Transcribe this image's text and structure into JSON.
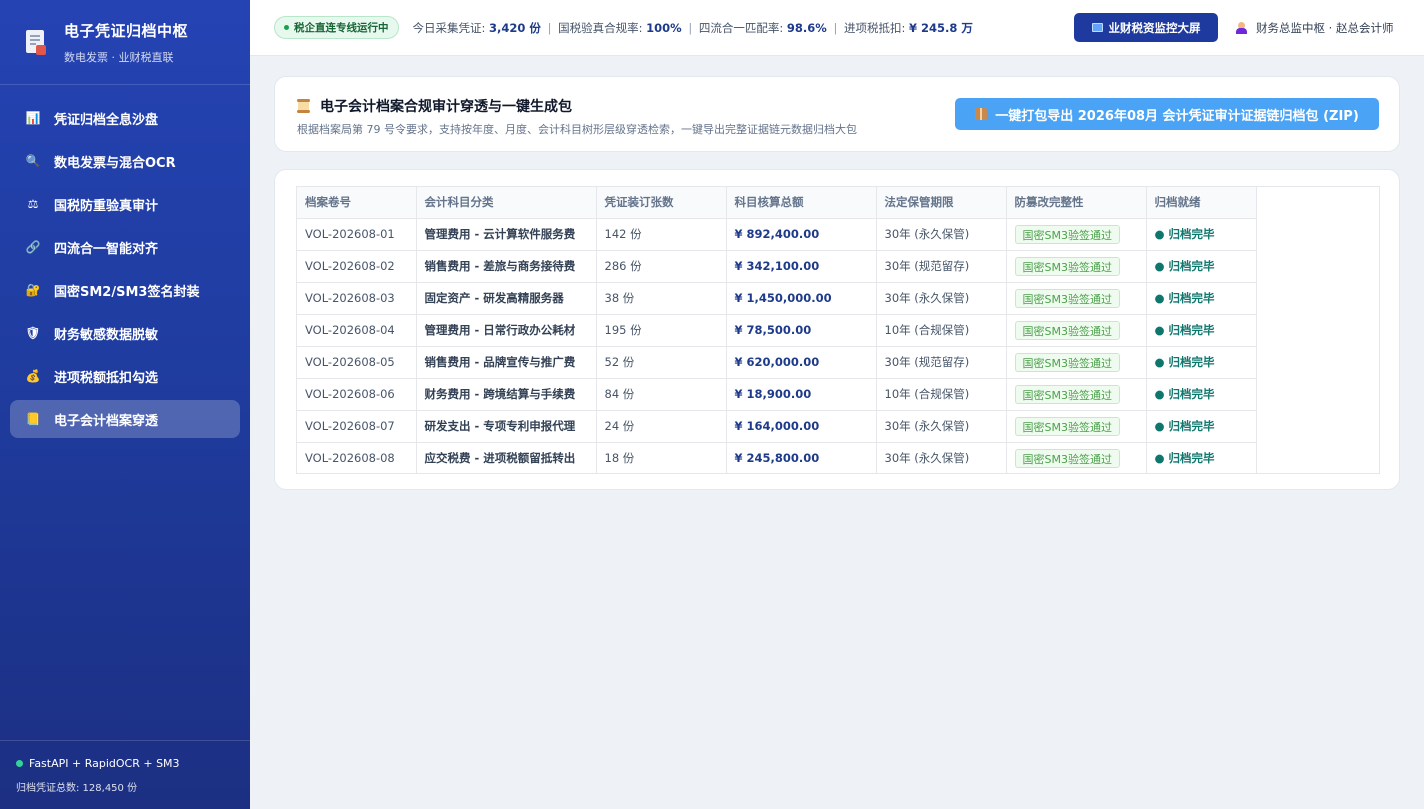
{
  "sidebar": {
    "brand_title": "电子凭证归档中枢",
    "brand_sub": "数电发票 · 业财税直联",
    "items": [
      {
        "label": "凭证归档全息沙盘",
        "icon": "bar-chart-icon",
        "glyph": "📊",
        "active": false
      },
      {
        "label": "数电发票与混合OCR",
        "icon": "magnifier-icon",
        "glyph": "🔍",
        "active": false
      },
      {
        "label": "国税防重验真审计",
        "icon": "scales-icon",
        "glyph": "⚖",
        "active": false
      },
      {
        "label": "四流合一智能对齐",
        "icon": "link-icon",
        "glyph": "🔗",
        "active": false
      },
      {
        "label": "国密SM2/SM3签名封装",
        "icon": "lock-icon",
        "glyph": "🔐",
        "active": false
      },
      {
        "label": "财务敏感数据脱敏",
        "icon": "shield-icon",
        "glyph": "🛡",
        "active": false
      },
      {
        "label": "进项税额抵扣勾选",
        "icon": "money-bag-icon",
        "glyph": "💰",
        "active": false
      },
      {
        "label": "电子会计档案穿透",
        "icon": "ledger-icon",
        "glyph": "📒",
        "active": true
      }
    ],
    "footer_tech": "FastAPI + RapidOCR + SM3",
    "footer_count": "归档凭证总数: 128,450 份"
  },
  "topbar": {
    "status": "税企直连专线运行中",
    "stats": {
      "collected_label": "今日采集凭证: ",
      "collected_value": "3,420 份",
      "verify_label": "国税验真合规率: ",
      "verify_value": "100%",
      "match_label": "四流合一匹配率: ",
      "match_value": "98.6%",
      "deduct_label": "进项税抵扣: ",
      "deduct_value": "¥ 245.8 万",
      "separator": "|"
    },
    "monitor_button": "业财税资监控大屏",
    "user": "财务总监中枢 · 赵总会计师"
  },
  "header_card": {
    "title": "电子会计档案合规审计穿透与一键生成包",
    "subtitle": "根据档案局第 79 号令要求，支持按年度、月度、会计科目树形层级穿透检索，一键导出完整证据链元数据归档大包",
    "export_button": "一键打包导出 2026年08月 会计凭证审计证据链归档包 (ZIP)"
  },
  "table": {
    "headers": [
      "档案卷号",
      "会计科目分类",
      "凭证装订张数",
      "科目核算总额",
      "法定保管期限",
      "防篡改完整性",
      "归档就绪"
    ],
    "rows": [
      {
        "vol": "VOL-202608-01",
        "subject": "管理费用 - 云计算软件服务费",
        "count": "142 份",
        "amount": "¥ 892,400.00",
        "period": "30年 (永久保管)",
        "integrity": "国密SM3验签通过",
        "ready": "● 归档完毕"
      },
      {
        "vol": "VOL-202608-02",
        "subject": "销售费用 - 差旅与商务接待费",
        "count": "286 份",
        "amount": "¥ 342,100.00",
        "period": "30年 (规范留存)",
        "integrity": "国密SM3验签通过",
        "ready": "● 归档完毕"
      },
      {
        "vol": "VOL-202608-03",
        "subject": "固定资产 - 研发高精服务器",
        "count": "38 份",
        "amount": "¥ 1,450,000.00",
        "period": "30年 (永久保管)",
        "integrity": "国密SM3验签通过",
        "ready": "● 归档完毕"
      },
      {
        "vol": "VOL-202608-04",
        "subject": "管理费用 - 日常行政办公耗材",
        "count": "195 份",
        "amount": "¥ 78,500.00",
        "period": "10年 (合规保管)",
        "integrity": "国密SM3验签通过",
        "ready": "● 归档完毕"
      },
      {
        "vol": "VOL-202608-05",
        "subject": "销售费用 - 品牌宣传与推广费",
        "count": "52 份",
        "amount": "¥ 620,000.00",
        "period": "30年 (规范留存)",
        "integrity": "国密SM3验签通过",
        "ready": "● 归档完毕"
      },
      {
        "vol": "VOL-202608-06",
        "subject": "财务费用 - 跨境结算与手续费",
        "count": "84 份",
        "amount": "¥ 18,900.00",
        "period": "10年 (合规保管)",
        "integrity": "国密SM3验签通过",
        "ready": "● 归档完毕"
      },
      {
        "vol": "VOL-202608-07",
        "subject": "研发支出 - 专项专利申报代理",
        "count": "24 份",
        "amount": "¥ 164,000.00",
        "period": "30年 (永久保管)",
        "integrity": "国密SM3验签通过",
        "ready": "● 归档完毕"
      },
      {
        "vol": "VOL-202608-08",
        "subject": "应交税费 - 进项税额留抵转出",
        "count": "18 份",
        "amount": "¥ 245,800.00",
        "period": "30年 (永久保管)",
        "integrity": "国密SM3验签通过",
        "ready": "● 归档完毕"
      }
    ]
  }
}
